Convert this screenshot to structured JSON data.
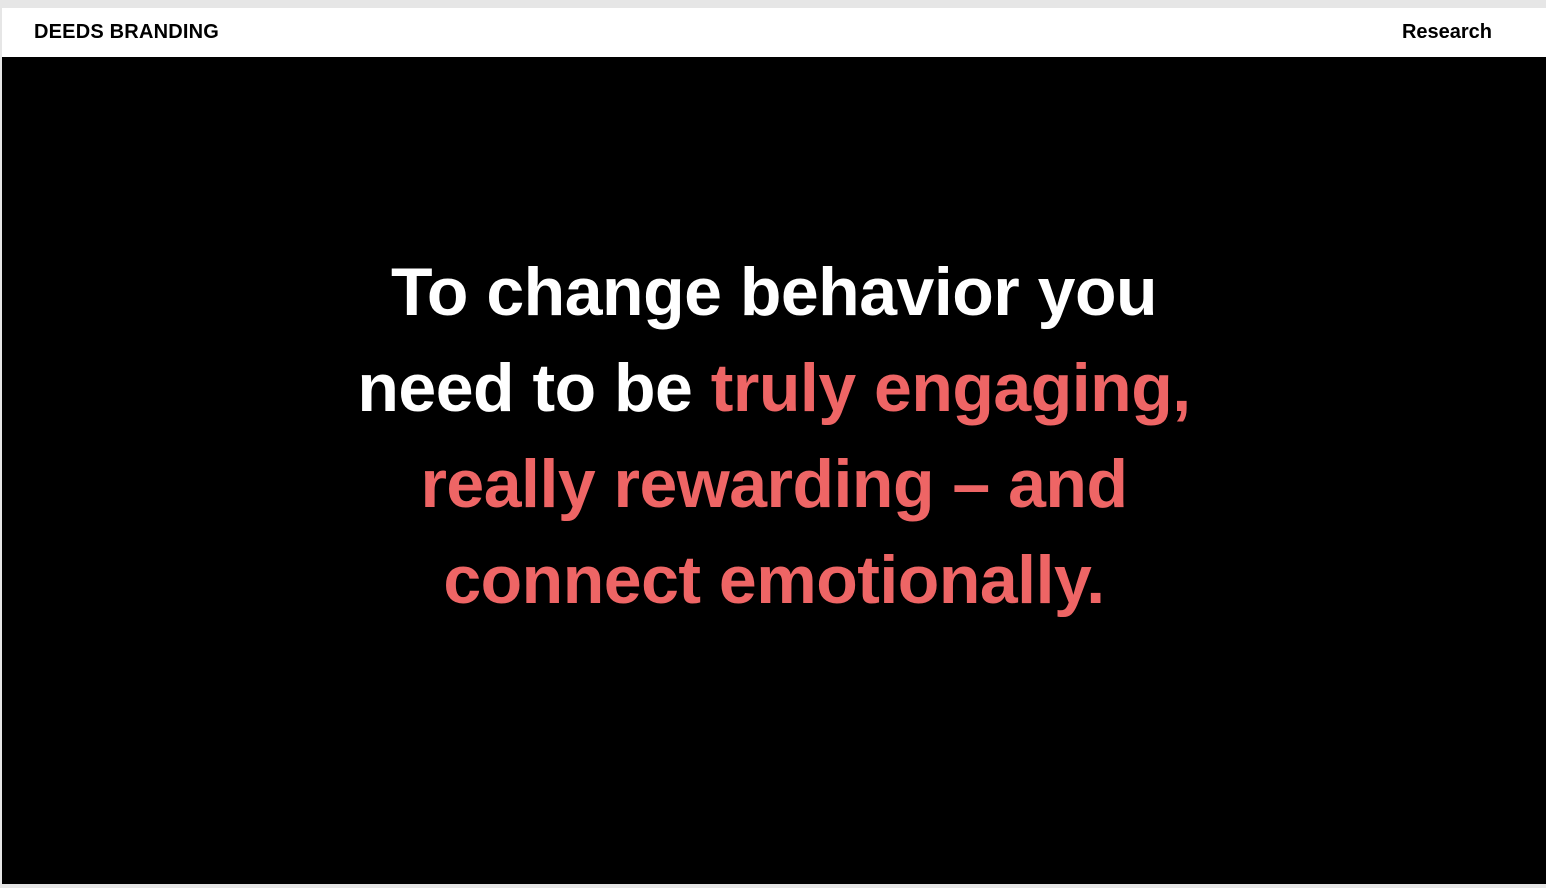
{
  "header": {
    "brand": "DEEDS BRANDING",
    "nav_link": "Research"
  },
  "hero": {
    "lines": [
      {
        "plain": "To change behavior you",
        "accent": ""
      },
      {
        "plain": "need to be ",
        "accent": "truly engaging,"
      },
      {
        "plain": "",
        "accent": "really rewarding – and"
      },
      {
        "plain": "",
        "accent": "connect emotionally."
      }
    ]
  },
  "colors": {
    "background": "#000000",
    "header_background": "#ffffff",
    "text": "#ffffff",
    "accent": "#ee6565"
  }
}
